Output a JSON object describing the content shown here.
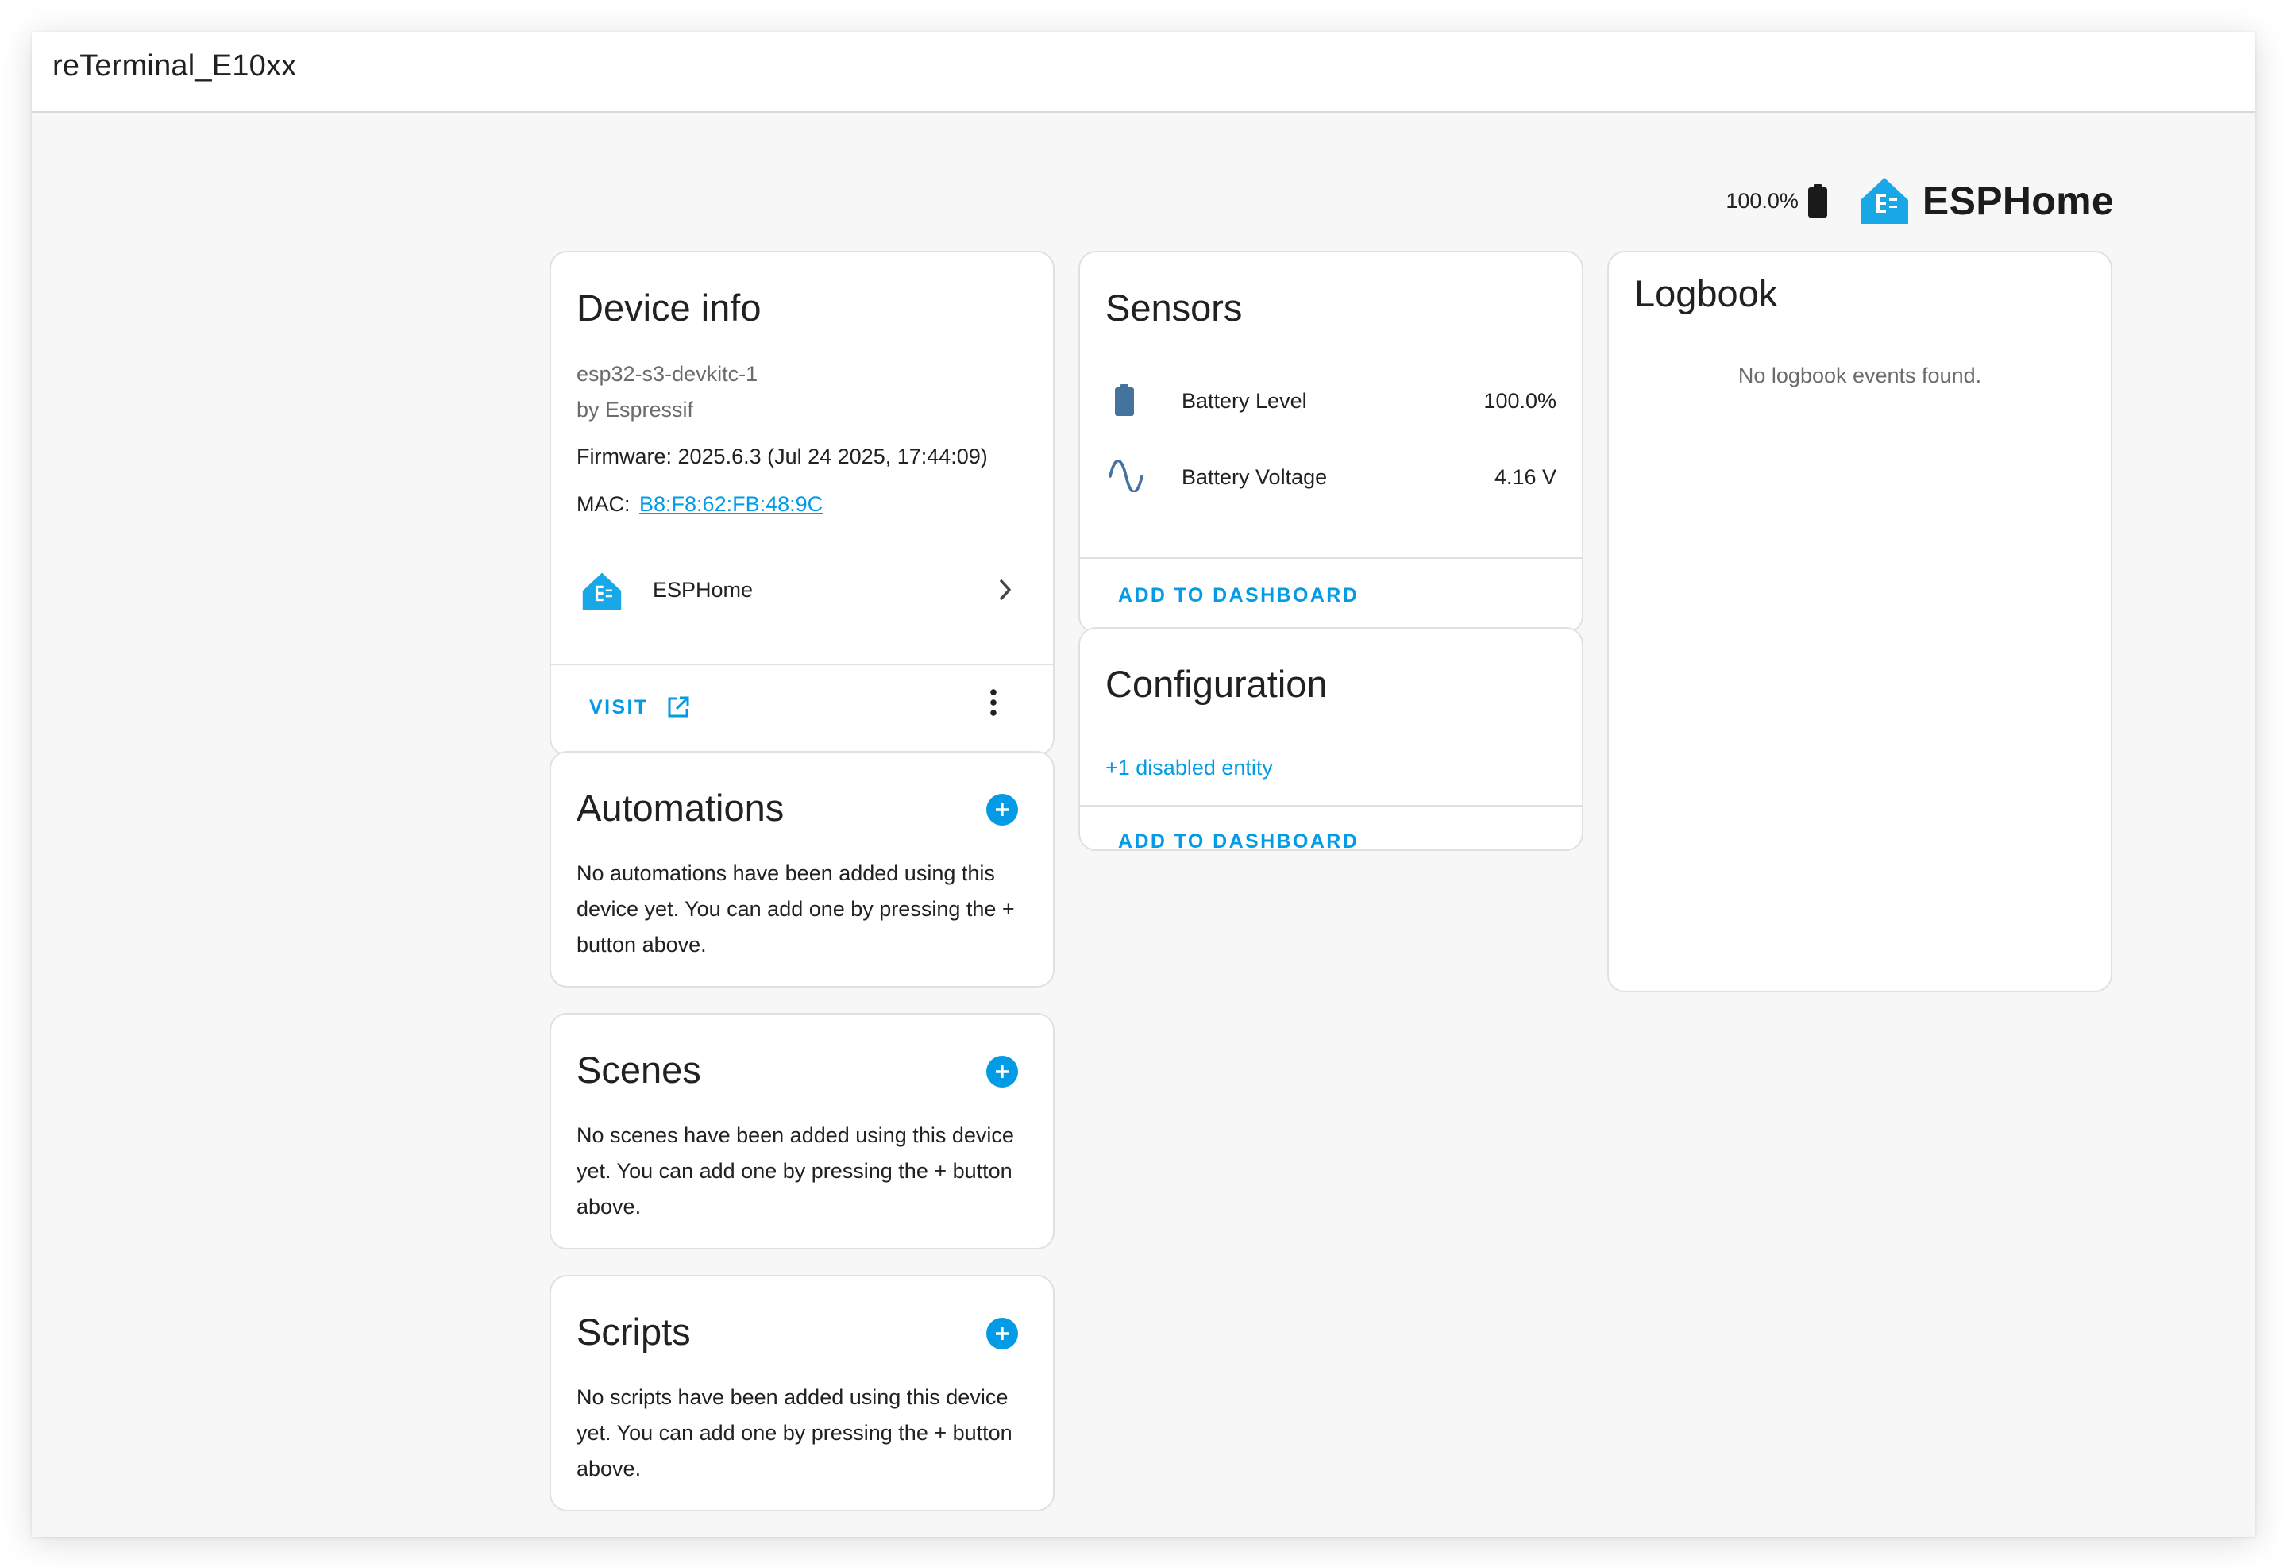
{
  "window": {
    "title": "reTerminal_E10xx"
  },
  "brand": {
    "battery_text": "100.0%",
    "name": "ESPHome"
  },
  "device_info": {
    "title": "Device info",
    "model": "esp32-s3-devkitc-1",
    "manufacturer": "by Espressif",
    "firmware": "Firmware: 2025.6.3 (Jul 24 2025, 17:44:09)",
    "mac_label": "MAC:",
    "mac_value": "B8:F8:62:FB:48:9C",
    "integration": "ESPHome",
    "visit_label": "VISIT"
  },
  "automations": {
    "title": "Automations",
    "text": "No automations have been added using this device yet. You can add one by pressing the + button above."
  },
  "scenes": {
    "title": "Scenes",
    "text": "No scenes have been added using this device yet. You can add one by pressing the + button above."
  },
  "scripts": {
    "title": "Scripts",
    "text": "No scripts have been added using this device yet. You can add one by pressing the + button above."
  },
  "sensors": {
    "title": "Sensors",
    "items": [
      {
        "icon": "battery-icon",
        "name": "Battery Level",
        "value": "100.0%"
      },
      {
        "icon": "sine-wave-icon",
        "name": "Battery Voltage",
        "value": "4.16 V"
      }
    ],
    "add_label": "ADD TO DASHBOARD"
  },
  "configuration": {
    "title": "Configuration",
    "disabled_text": "+1 disabled entity",
    "add_label": "ADD TO DASHBOARD"
  },
  "logbook": {
    "title": "Logbook",
    "empty_text": "No logbook events found."
  },
  "colors": {
    "accent": "#039be5",
    "esphome_blue": "#18a8e8",
    "sensor_icon": "#44739e"
  }
}
